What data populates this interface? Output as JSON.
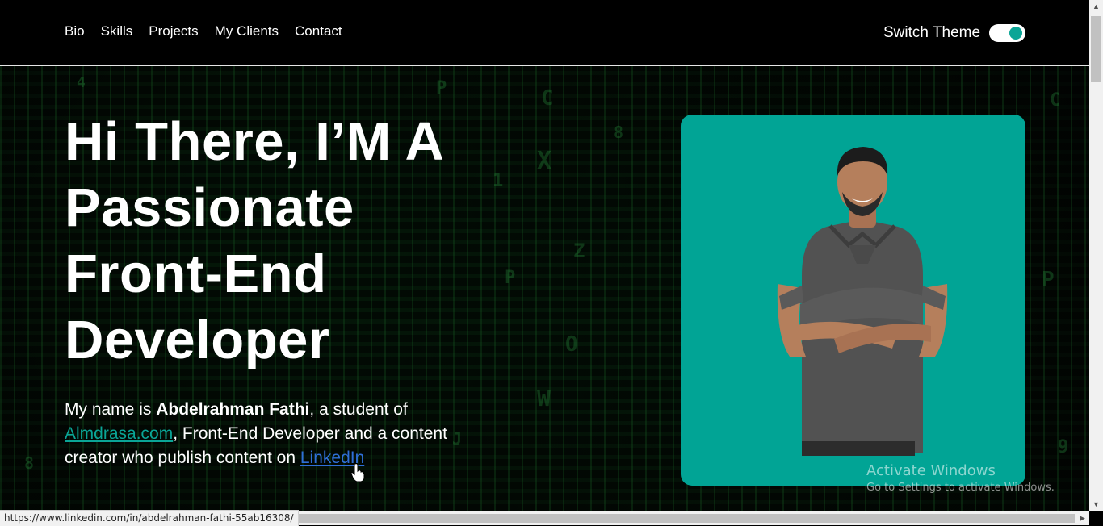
{
  "nav": {
    "links": [
      "Bio",
      "Skills",
      "Projects",
      "My Clients",
      "Contact"
    ],
    "switch_theme_label": "Switch Theme",
    "theme_toggle_on": true
  },
  "hero": {
    "headline_lines": [
      "Hi There, I’M A",
      "Passionate",
      "Front-End",
      "Developer"
    ],
    "intro": {
      "prefix": "My name is ",
      "name": "Abdelrahman Fathi",
      "after_name": ", a student of ",
      "school_link": "Almdrasa.com",
      "middle": ", Front-End Developer and a content creator who publish content on ",
      "linkedin_link": "LinkedIn"
    },
    "photo_alt": "Portrait of Abdelrahman Fathi"
  },
  "os_overlay": {
    "title": "Activate Windows",
    "subtitle": "Go to Settings to activate Windows."
  },
  "status_bar": {
    "url": "https://www.linkedin.com/in/abdelrahman-fathi-55ab16308/"
  },
  "colors": {
    "accent": "#0aa596",
    "link": "#2f6fd8",
    "background": "#000000"
  }
}
